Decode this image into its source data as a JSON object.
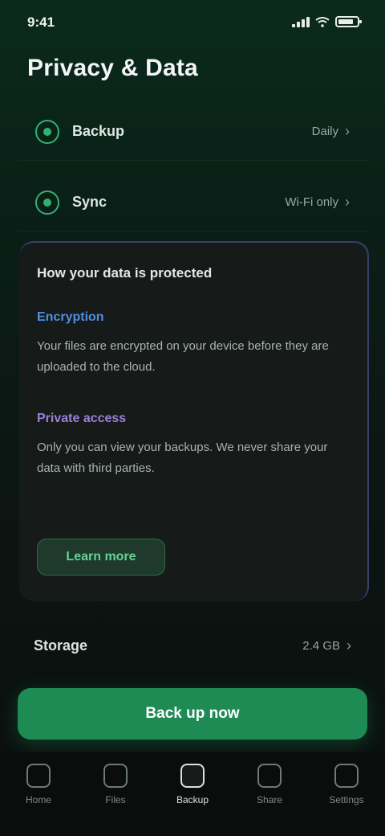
{
  "status_bar": {
    "time": "9:41"
  },
  "header": {
    "title": "Privacy & Data"
  },
  "rows": [
    {
      "label": "Backup",
      "value": "Daily",
      "icon": "shield-icon"
    },
    {
      "label": "Sync",
      "value": "Wi-Fi only",
      "icon": "sync-icon"
    }
  ],
  "info_card": {
    "heading": "How your data is protected",
    "sections": [
      {
        "title": "Encryption",
        "text": "Your files are encrypted on your device before they are uploaded to the cloud."
      },
      {
        "title": "Private access",
        "text": "Only you can view your backups. We never share your data with third parties."
      }
    ],
    "action_label": "Learn more"
  },
  "lower_row": {
    "label": "Storage",
    "value": "2.4 GB"
  },
  "primary_button": {
    "label": "Back up now"
  },
  "bottom_nav": {
    "items": [
      {
        "label": "Home",
        "icon": "home-icon"
      },
      {
        "label": "Files",
        "icon": "folder-icon"
      },
      {
        "label": "Backup",
        "icon": "cloud-icon"
      },
      {
        "label": "Share",
        "icon": "share-icon"
      },
      {
        "label": "Settings",
        "icon": "gear-icon"
      }
    ],
    "active_index": 2
  },
  "colors": {
    "accent": "#1e8b55",
    "blue_heading": "#4f8ee0",
    "purple_heading": "#9b7fd8"
  }
}
